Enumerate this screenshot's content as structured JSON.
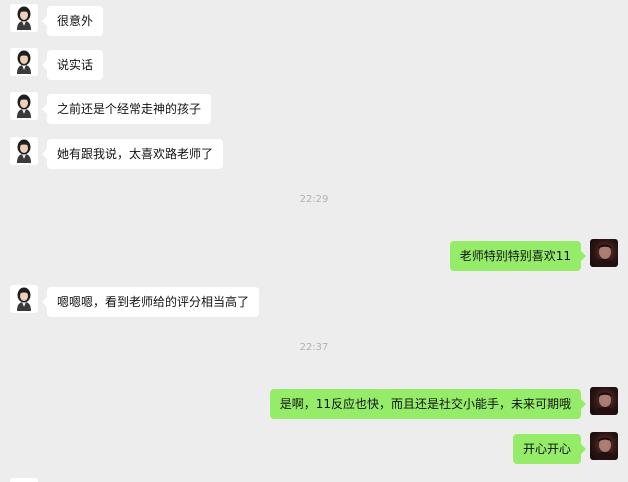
{
  "conversation": {
    "messages": [
      {
        "side": "left",
        "text": "很意外"
      },
      {
        "side": "left",
        "text": "说实话"
      },
      {
        "side": "left",
        "text": "之前还是个经常走神的孩子"
      },
      {
        "side": "left",
        "text": "她有跟我说，太喜欢路老师了"
      },
      {
        "side": "right",
        "text": "老师特别特别喜欢11"
      },
      {
        "side": "left",
        "text": "嗯嗯嗯，看到老师给的评分相当高了"
      },
      {
        "side": "right",
        "text": "是啊，11反应也快，而且还是社交小能手，未来可期哦"
      },
      {
        "side": "right",
        "text": "开心开心"
      }
    ],
    "timestamps": [
      "22:29",
      "22:37"
    ]
  },
  "colors": {
    "background": "#ededed",
    "bubble_self": "#95ec69",
    "bubble_other": "#ffffff",
    "timestamp_text": "#b2b2b2"
  },
  "icons": {
    "other_avatar": "woman-portrait-icon",
    "self_avatar": "man-portrait-icon"
  }
}
